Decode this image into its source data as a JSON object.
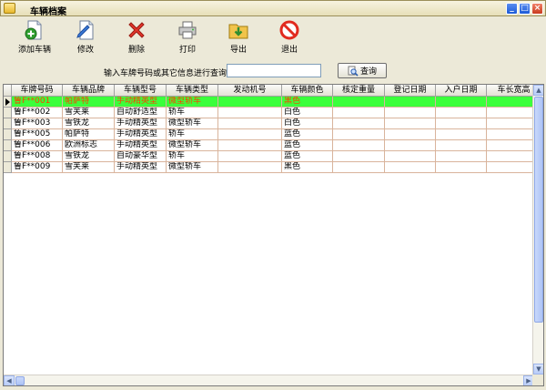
{
  "window": {
    "title": "车辆档案",
    "minimize": "_",
    "maximize": "□",
    "close": "×"
  },
  "toolbar": [
    {
      "key": "add",
      "label": "添加车辆",
      "icon": "add-document-icon"
    },
    {
      "key": "edit",
      "label": "修改",
      "icon": "edit-document-icon"
    },
    {
      "key": "delete",
      "label": "删除",
      "icon": "red-x-icon"
    },
    {
      "key": "print",
      "label": "打印",
      "icon": "printer-icon"
    },
    {
      "key": "export",
      "label": "导出",
      "icon": "export-folder-icon"
    },
    {
      "key": "exit",
      "label": "退出",
      "icon": "no-entry-icon"
    }
  ],
  "search": {
    "label": "输入车牌号码或其它信息进行查询：",
    "value": "",
    "button_label": "查询"
  },
  "table": {
    "columns": [
      "车牌号码",
      "车辆品牌",
      "车辆型号",
      "车辆类型",
      "发动机号",
      "车辆颜色",
      "核定重量",
      "登记日期",
      "入户日期",
      "车长宽高"
    ],
    "rows": [
      [
        "鲁F**001",
        "帕萨特",
        "手动精英型",
        "微型轿车",
        "",
        "黑色",
        "",
        "",
        "",
        ""
      ],
      [
        "鲁F**002",
        "雪芙莱",
        "自动舒适型",
        "轿车",
        "",
        "白色",
        "",
        "",
        "",
        ""
      ],
      [
        "鲁F**003",
        "雪铁龙",
        "手动精英型",
        "微型轿车",
        "",
        "白色",
        "",
        "",
        "",
        ""
      ],
      [
        "鲁F**005",
        "帕萨特",
        "手动精英型",
        "轿车",
        "",
        "蓝色",
        "",
        "",
        "",
        ""
      ],
      [
        "鲁F**006",
        "欧洲标志",
        "手动精英型",
        "微型轿车",
        "",
        "蓝色",
        "",
        "",
        "",
        ""
      ],
      [
        "鲁F**008",
        "雪铁龙",
        "自动豪华型",
        "轿车",
        "",
        "蓝色",
        "",
        "",
        "",
        ""
      ],
      [
        "鲁F**009",
        "雪芙莱",
        "手动精英型",
        "微型轿车",
        "",
        "黑色",
        "",
        "",
        "",
        ""
      ]
    ],
    "selected_row": 0
  },
  "colors": {
    "selected_row_bg": "#3bff3b",
    "selected_row_text": "#ff3c00",
    "grid_line": "#d9b49c"
  }
}
